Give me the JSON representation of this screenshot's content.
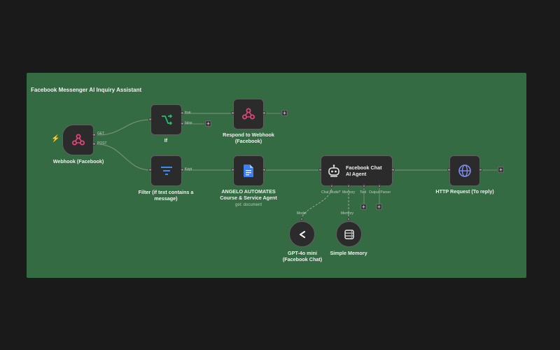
{
  "sticky": {
    "title": "Facebook Messenger AI Inquiry Assistant"
  },
  "nodes": {
    "webhook": {
      "label": "Webhook (Facebook)",
      "outputs": [
        "GET",
        "POST"
      ],
      "icon": "webhook-icon",
      "trigger_icon": "lightning-icon"
    },
    "if": {
      "label": "If",
      "outputs": [
        "true",
        "false"
      ],
      "icon": "branch-icon"
    },
    "respond": {
      "label_line1": "Respond to Webhook",
      "label_line2": "(Facebook)",
      "icon": "webhook-icon"
    },
    "filter": {
      "label_line1": "Filter (if text contains a",
      "label_line2": "message)",
      "outputs": [
        "Kept"
      ],
      "icon": "filter-icon"
    },
    "gdoc": {
      "label_line1": "ANGELO AUTOMATES",
      "label_line2": "Course & Service Agent",
      "sublabel": "get: document",
      "icon": "google-docs-icon"
    },
    "agent": {
      "label_line1": "Facebook Chat",
      "label_line2": "AI Agent",
      "inputs": [
        "Chat Model*",
        "Memory",
        "Tool",
        "Output Parser"
      ],
      "icon": "robot-icon"
    },
    "http": {
      "label": "HTTP Request (To reply)",
      "icon": "globe-icon"
    },
    "gpt": {
      "label_line1": "GPT-4o mini",
      "label_line2": "(Facebook Chat)",
      "connector": "Model",
      "icon": "openai-icon"
    },
    "memory": {
      "label": "Simple Memory",
      "connector": "Memory",
      "icon": "database-icon"
    }
  },
  "add_button": "+",
  "colors": {
    "background": "#1a1a1a",
    "sticky": "#356b42",
    "node": "#2b2b2b",
    "webhook": "#e0457b",
    "if": "#1ec26a",
    "filter": "#3f8cf0",
    "gdoc": "#3f7ef0"
  }
}
